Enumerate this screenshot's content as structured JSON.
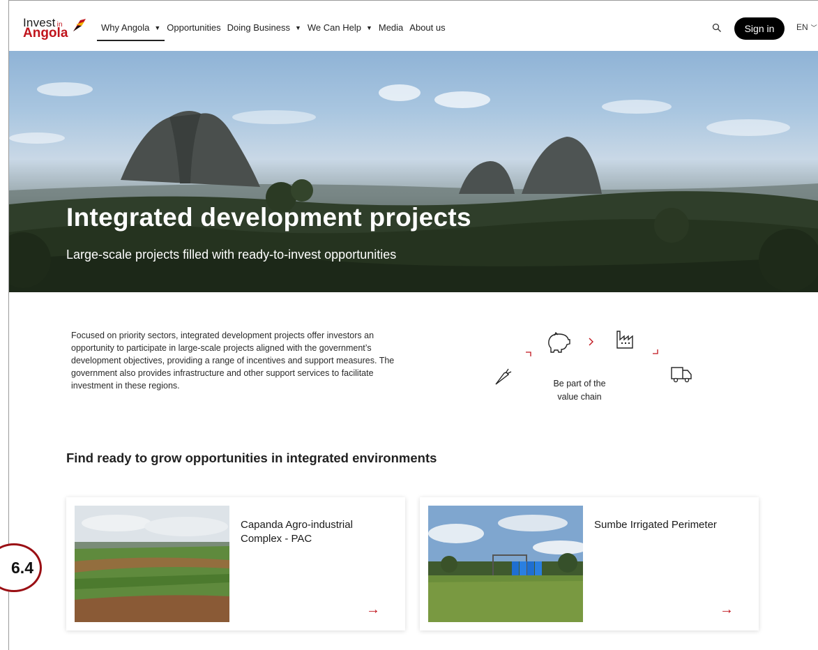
{
  "logo": {
    "line1": "Invest",
    "line1_small": "in",
    "line2": "Angola"
  },
  "nav": {
    "items": [
      {
        "label": "Why Angola",
        "dropdown": true,
        "active": true
      },
      {
        "label": "Opportunities",
        "dropdown": false
      },
      {
        "label": "Doing Business",
        "dropdown": true
      },
      {
        "label": "We Can Help",
        "dropdown": true
      },
      {
        "label": "Media",
        "dropdown": false
      },
      {
        "label": "About us",
        "dropdown": false
      }
    ],
    "signin_label": "Sign in",
    "language": "EN"
  },
  "hero": {
    "title": "Integrated development projects",
    "subtitle": "Large-scale projects filled with ready-to-invest opportunities"
  },
  "intro": {
    "text": "Focused on priority sectors, integrated development projects offer investors an opportunity to participate in large-scale projects aligned with the government’s development objectives, providing a range of incentives and support measures. The government also provides infrastructure and other support services to facilitate investment in these regions."
  },
  "value_chain": {
    "line1": "Be part of the",
    "line2": "value chain",
    "icons": [
      "carrot-icon",
      "pig-icon",
      "factory-icon",
      "truck-icon"
    ]
  },
  "section": {
    "title": "Find ready to grow opportunities in integrated environments"
  },
  "cards": [
    {
      "title": "Capanda Agro-industrial Complex - PAC"
    },
    {
      "title": "Sumbe Irrigated Perimeter"
    }
  ],
  "badge": {
    "text": "6.4"
  },
  "colors": {
    "accent": "#c0141c",
    "button_bg": "#000000"
  }
}
